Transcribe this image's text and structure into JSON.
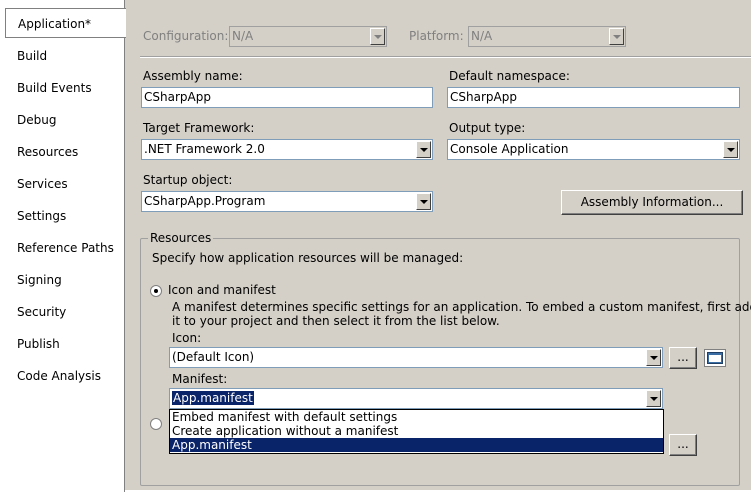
{
  "tabs": [
    {
      "label": "Application*"
    },
    {
      "label": "Build"
    },
    {
      "label": "Build Events"
    },
    {
      "label": "Debug"
    },
    {
      "label": "Resources"
    },
    {
      "label": "Services"
    },
    {
      "label": "Settings"
    },
    {
      "label": "Reference Paths"
    },
    {
      "label": "Signing"
    },
    {
      "label": "Security"
    },
    {
      "label": "Publish"
    },
    {
      "label": "Code Analysis"
    }
  ],
  "header": {
    "configuration_label": "Configuration:",
    "configuration_value": "N/A",
    "platform_label": "Platform:",
    "platform_value": "N/A"
  },
  "form": {
    "assembly_name_label": "Assembly name:",
    "assembly_name_value": "CSharpApp",
    "default_namespace_label": "Default namespace:",
    "default_namespace_value": "CSharpApp",
    "target_framework_label": "Target Framework:",
    "target_framework_value": ".NET Framework 2.0",
    "output_type_label": "Output type:",
    "output_type_value": "Console Application",
    "startup_object_label": "Startup object:",
    "startup_object_value": "CSharpApp.Program",
    "assembly_info_button": "Assembly Information..."
  },
  "resources": {
    "group_title": "Resources",
    "description": "Specify how application resources will be managed:",
    "icon_manifest_option": "Icon and manifest",
    "manifest_help_line1": "A manifest determines specific settings for an application. To embed a custom manifest, first add",
    "manifest_help_line2": "it to your project and then select it from the list below.",
    "icon_label": "Icon:",
    "icon_value": "(Default Icon)",
    "browse_button": "...",
    "manifest_label": "Manifest:",
    "manifest_value": "App.manifest",
    "manifest_options": [
      "Embed manifest with default settings",
      "Create application without a manifest",
      "App.manifest"
    ],
    "resource_file_browse_button": "..."
  }
}
